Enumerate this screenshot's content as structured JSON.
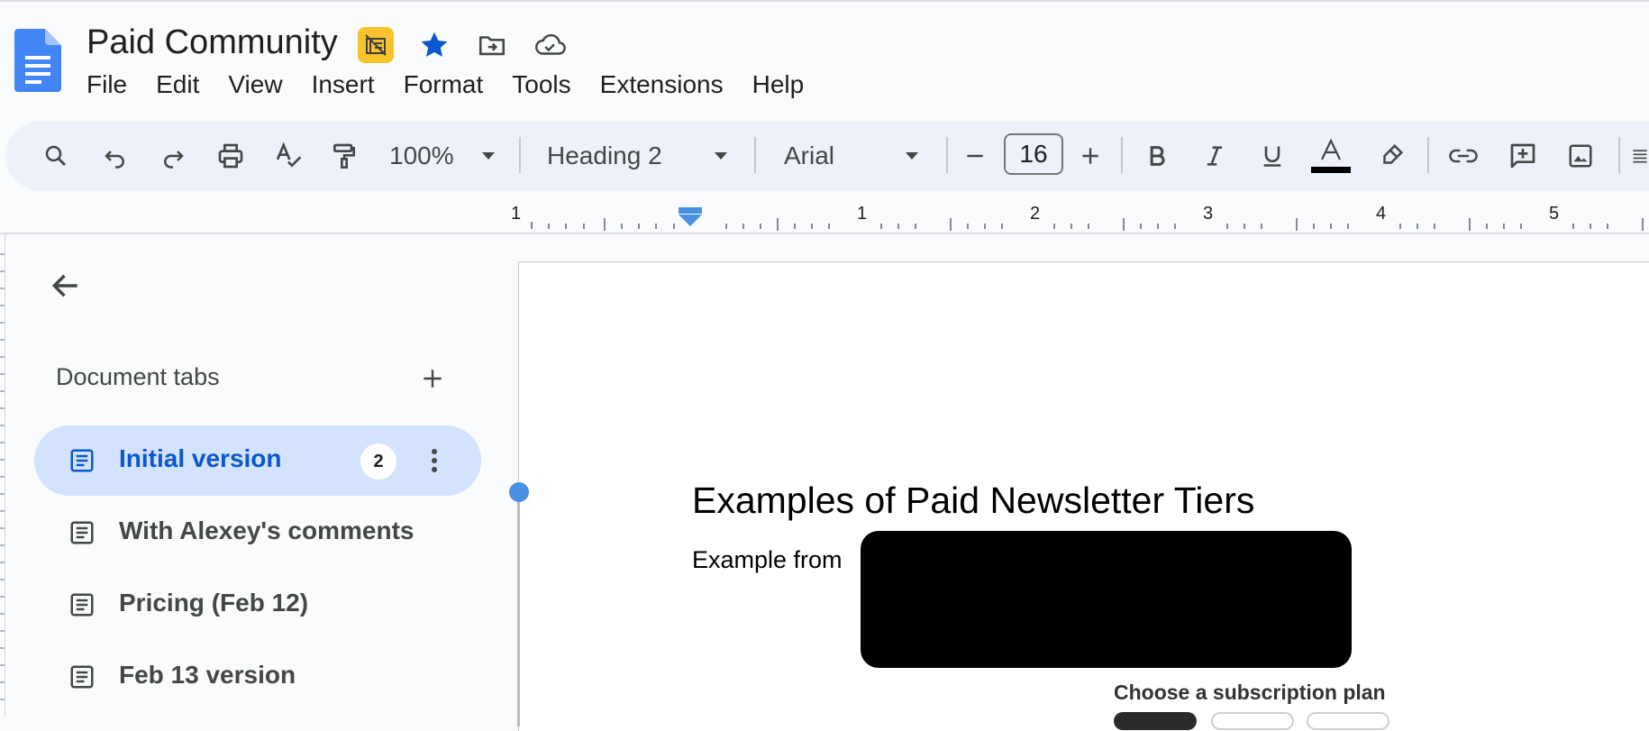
{
  "document": {
    "title": "Paid Community"
  },
  "menu": [
    "File",
    "Edit",
    "View",
    "Insert",
    "Format",
    "Tools",
    "Extensions",
    "Help"
  ],
  "toolbar": {
    "zoom": "100%",
    "style": "Heading 2",
    "font": "Arial",
    "font_size": "16",
    "text_color": "#000000"
  },
  "ruler": {
    "labels": [
      "1",
      "1",
      "2",
      "3",
      "4",
      "5"
    ]
  },
  "sidebar": {
    "heading": "Document tabs",
    "tabs": [
      {
        "label": "Initial version",
        "badge": "2",
        "active": true
      },
      {
        "label": "With Alexey's comments"
      },
      {
        "label": "Pricing (Feb 12)"
      },
      {
        "label": "Feb 13 version"
      }
    ]
  },
  "page": {
    "heading": "Examples of Paid Newsletter Tiers",
    "body": "Example from",
    "caption": "Choose a subscription plan"
  },
  "colors": {
    "accent": "#0b57d0",
    "active_tab_bg": "#d3e3fd",
    "toolbar_bg": "#edf2fa",
    "badge": "#f8c32b",
    "star": "#0b57d0"
  }
}
